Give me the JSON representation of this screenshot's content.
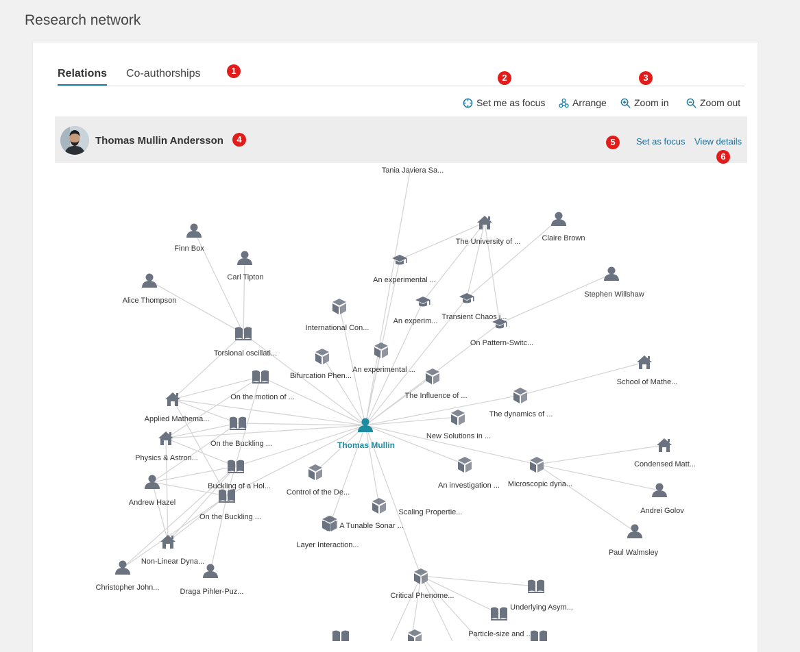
{
  "page_title": "Research network",
  "tabs": [
    {
      "label": "Relations",
      "active": true
    },
    {
      "label": "Co-authorships",
      "active": false
    }
  ],
  "toolbar": {
    "set_me_as_focus": "Set me as focus",
    "arrange": "Arrange",
    "zoom_in": "Zoom in",
    "zoom_out": "Zoom out"
  },
  "selected_person": {
    "name": "Thomas Mullin Andersson",
    "set_as_focus": "Set as focus",
    "view_details": "View details"
  },
  "annotations": [
    "1",
    "2",
    "3",
    "4",
    "5",
    "6"
  ],
  "colors": {
    "accent": "#1f7a9f",
    "center_node": "#1d8ba0",
    "node_icon": "#6b7280",
    "annotation_badge": "#e21b1b"
  },
  "graph": {
    "center": "Thomas Mullin",
    "nodes": [
      {
        "label": "Tania Javiera Sa...",
        "type": "none"
      },
      {
        "label": "The University of ...",
        "type": "organisation"
      },
      {
        "label": "Claire Brown",
        "type": "person"
      },
      {
        "label": "Finn Box",
        "type": "person"
      },
      {
        "label": "Carl Tipton",
        "type": "person"
      },
      {
        "label": "An experimental ...",
        "type": "thesis"
      },
      {
        "label": "Alice Thompson",
        "type": "person"
      },
      {
        "label": "Stephen Willshaw",
        "type": "person"
      },
      {
        "label": "An experim...",
        "type": "thesis"
      },
      {
        "label": "Transient Chaos i...",
        "type": "thesis"
      },
      {
        "label": "International Con...",
        "type": "project"
      },
      {
        "label": "On Pattern-Switc...",
        "type": "thesis"
      },
      {
        "label": "Torsional oscillati...",
        "type": "book"
      },
      {
        "label": "An experimental ...",
        "type": "project"
      },
      {
        "label": "Bifurcation Phen...",
        "type": "project"
      },
      {
        "label": "School of Mathe...",
        "type": "organisation"
      },
      {
        "label": "On the motion of ...",
        "type": "book"
      },
      {
        "label": "The Influence of ...",
        "type": "project"
      },
      {
        "label": "Applied Mathema...",
        "type": "organisation"
      },
      {
        "label": "The dynamics of ...",
        "type": "project"
      },
      {
        "label": "On the Buckling ...",
        "type": "book"
      },
      {
        "label": "New Solutions in ...",
        "type": "project"
      },
      {
        "label": "Physics & Astron...",
        "type": "organisation"
      },
      {
        "label": "Condensed Matt...",
        "type": "organisation"
      },
      {
        "label": "Buckling of a Hol...",
        "type": "book"
      },
      {
        "label": "Control of the De...",
        "type": "project"
      },
      {
        "label": "An investigation ...",
        "type": "project"
      },
      {
        "label": "Microscopic dyna...",
        "type": "project"
      },
      {
        "label": "Andrew Hazel",
        "type": "person"
      },
      {
        "label": "On the Buckling ...",
        "type": "book"
      },
      {
        "label": "Andrei Golov",
        "type": "person"
      },
      {
        "label": "Scaling Propertie...",
        "type": "project"
      },
      {
        "label": "A Tunable Sonar ...",
        "type": "project"
      },
      {
        "label": "Layer Interaction...",
        "type": "project"
      },
      {
        "label": "Paul Walmsley",
        "type": "person"
      },
      {
        "label": "Non-Linear Dyna...",
        "type": "organisation"
      },
      {
        "label": "Christopher John...",
        "type": "person"
      },
      {
        "label": "Draga Pihler-Puz...",
        "type": "person"
      },
      {
        "label": "Critical Phenome...",
        "type": "project"
      },
      {
        "label": "Underlying Asym...",
        "type": "book"
      },
      {
        "label": "Particle-size and ...",
        "type": "book"
      }
    ]
  }
}
